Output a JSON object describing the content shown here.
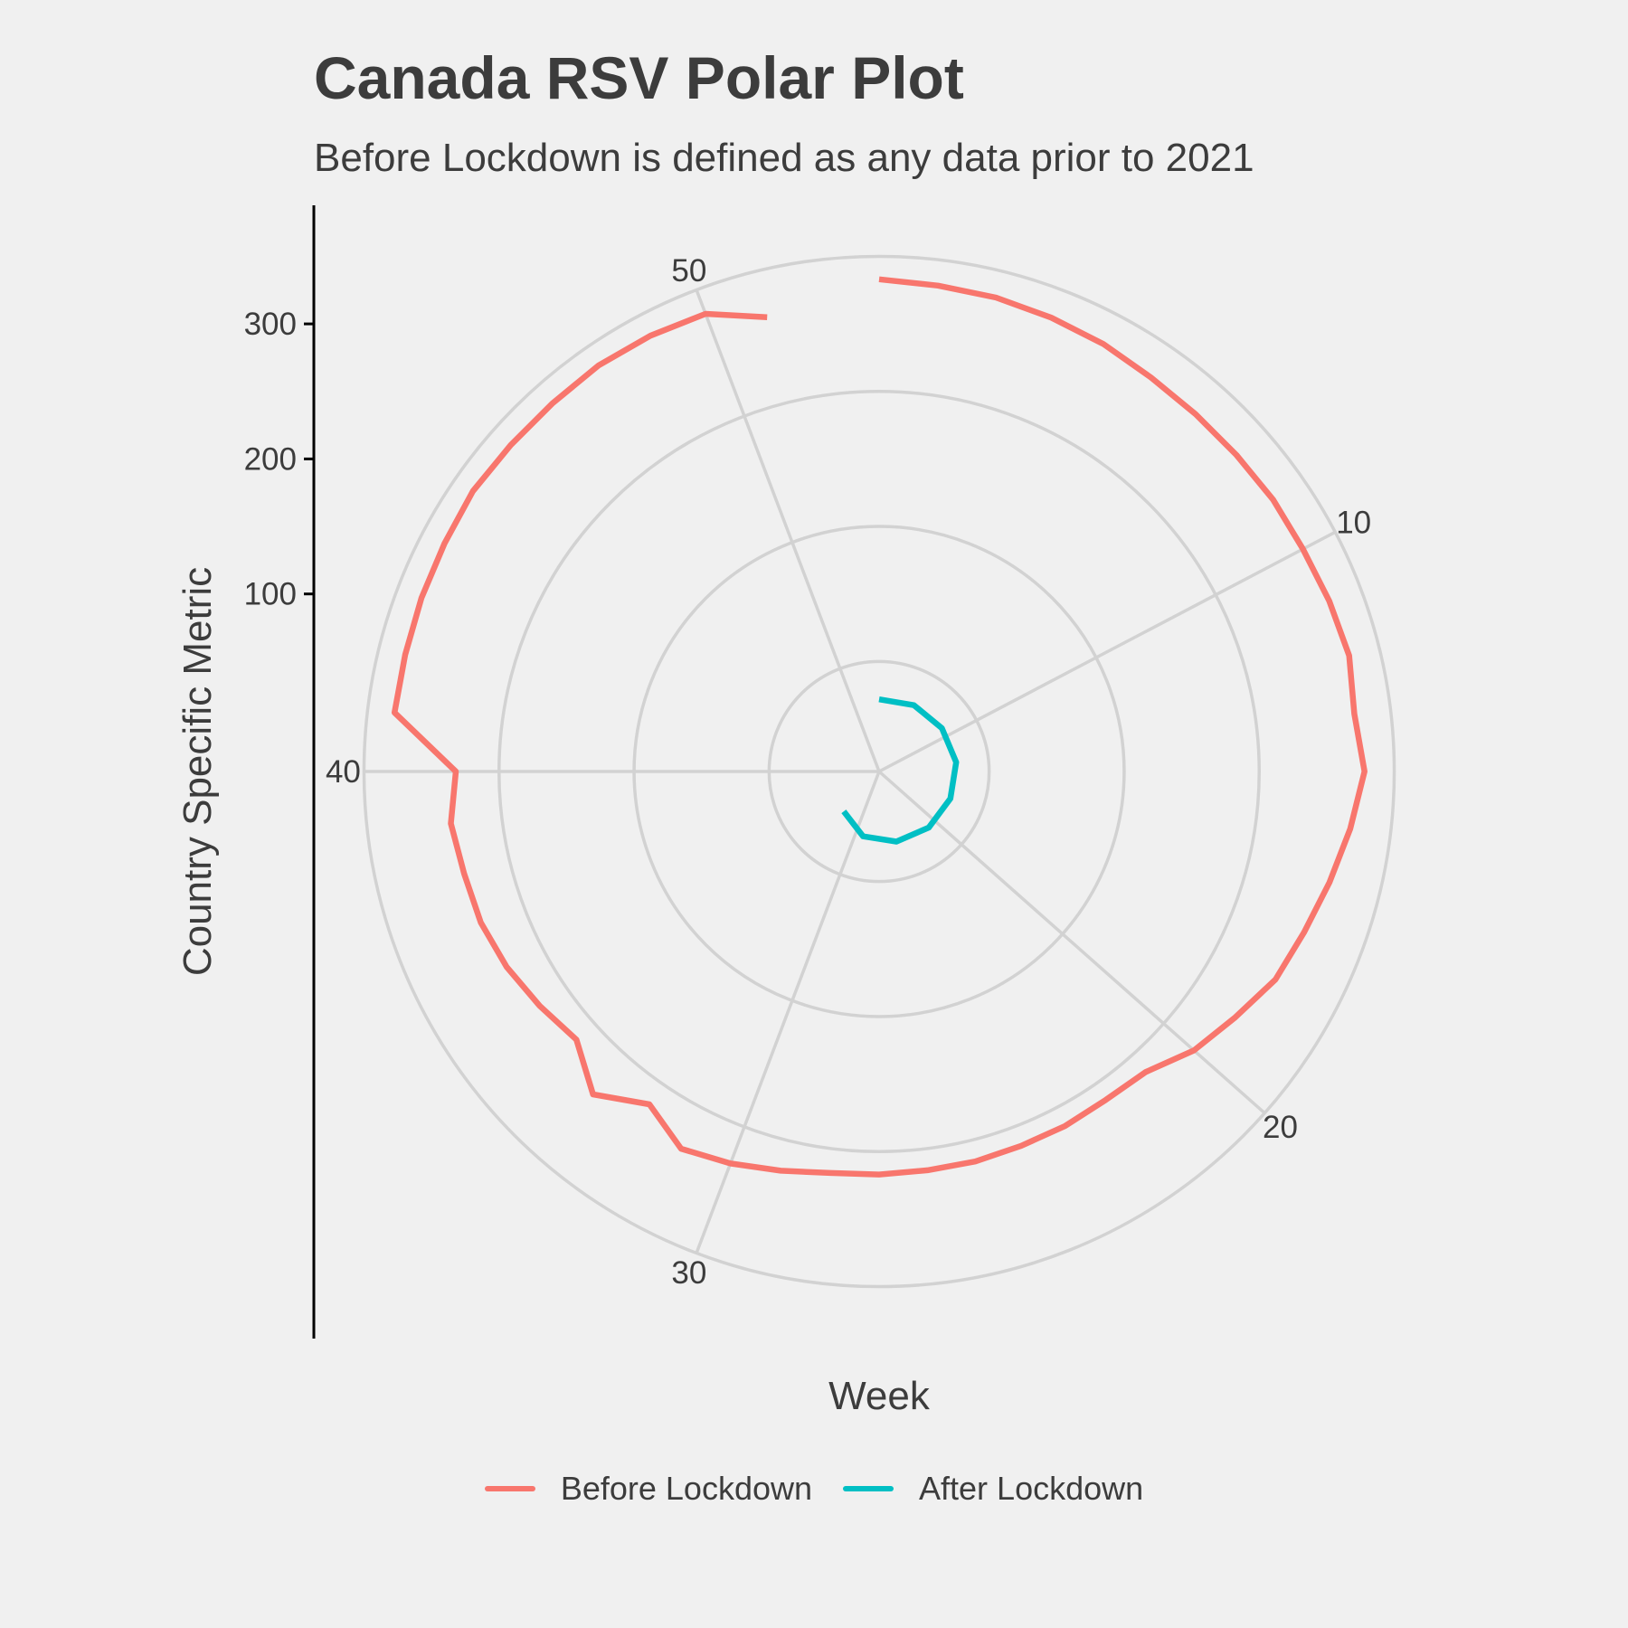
{
  "chart_data": {
    "type": "line",
    "coord": "polar",
    "title": "Canada RSV Polar Plot",
    "subtitle": "Before Lockdown is defined as any data prior to 2021",
    "xlabel": "Week",
    "ylabel": "Country Specific Metric",
    "x_ticks": [
      "10",
      "20",
      "30",
      "40",
      "50"
    ],
    "x_tick_values": [
      10,
      20,
      30,
      40,
      50
    ],
    "y_ticks": [
      "100",
      "200",
      "300"
    ],
    "y_tick_values": [
      100,
      200,
      300
    ],
    "x_range": [
      1,
      53
    ],
    "y_range": [
      0,
      380
    ],
    "grid": true,
    "legend_position": "bottom",
    "series": [
      {
        "name": "Before Lockdown",
        "color": "#F8766D",
        "x": [
          1,
          2,
          3,
          4,
          5,
          6,
          7,
          8,
          9,
          10,
          11,
          12,
          13,
          14,
          15,
          16,
          17,
          18,
          19,
          20,
          21,
          22,
          23,
          24,
          25,
          26,
          27,
          28,
          29,
          30,
          31,
          32,
          33,
          34,
          35,
          36,
          37,
          38,
          39,
          40,
          41,
          42,
          43,
          44,
          45,
          46,
          47,
          48,
          49,
          50,
          51
        ],
        "y": [
          333,
          331,
          330,
          328,
          326,
          323,
          322,
          322,
          323,
          323,
          325,
          327,
          323,
          328,
          320,
          312,
          305,
          300,
          289,
          280,
          266,
          264,
          265,
          265,
          266,
          266,
          267,
          268,
          273,
          279,
          284,
          268,
          288,
          268,
          274,
          280,
          284,
          285,
          288,
          282,
          330,
          330,
          331,
          332,
          334,
          333,
          333,
          334,
          333,
          331,
          315
        ]
      },
      {
        "name": "After Lockdown",
        "color": "#00BFC4",
        "x": [
          1,
          5,
          9,
          13,
          17,
          21,
          25,
          29,
          33
        ],
        "y": [
          22,
          24,
          25,
          26,
          25,
          24,
          22,
          18,
          8
        ]
      }
    ]
  }
}
